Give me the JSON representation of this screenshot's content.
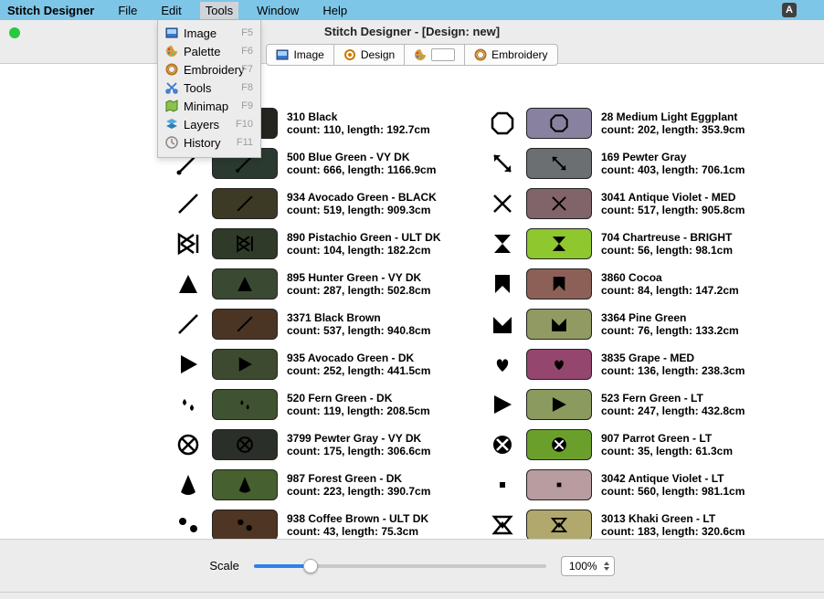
{
  "app_name": "Stitch Designer",
  "menubar": [
    "File",
    "Edit",
    "Tools",
    "Window",
    "Help"
  ],
  "open_menu_index": 2,
  "dropdown": [
    {
      "label": "Image",
      "key": "F5",
      "icon": "image"
    },
    {
      "label": "Palette",
      "key": "F6",
      "icon": "palette"
    },
    {
      "label": "Embroidery",
      "key": "F7",
      "icon": "hoop"
    },
    {
      "label": "Tools",
      "key": "F8",
      "icon": "scissors"
    },
    {
      "label": "Minimap",
      "key": "F9",
      "icon": "map"
    },
    {
      "label": "Layers",
      "key": "F10",
      "icon": "layers"
    },
    {
      "label": "History",
      "key": "F11",
      "icon": "clock"
    }
  ],
  "window_title": "Stitch Designer - [Design: new]",
  "toolbar": {
    "image": "Image",
    "design": "Design",
    "embroidery": "Embroidery"
  },
  "scale": {
    "label": "Scale",
    "value": "100%"
  },
  "left": [
    {
      "sym": "blank",
      "color": "#23251e",
      "stroke": "#000",
      "name": "310 Black",
      "stats": "count: 110, length: 192.7cm"
    },
    {
      "sym": "line_h",
      "color": "#2b3a30",
      "stroke": "#000",
      "name": "500 Blue Green - VY DK",
      "stats": "count: 666, length: 1166.9cm"
    },
    {
      "sym": "slash",
      "color": "#3c3a25",
      "stroke": "#000",
      "name": "934 Avocado Green - BLACK",
      "stats": "count: 519, length: 909.3cm"
    },
    {
      "sym": "tri_left",
      "color": "#2f3a28",
      "stroke": "#000",
      "name": "890 Pistachio Green - ULT DK",
      "stats": "count: 104, length: 182.2cm"
    },
    {
      "sym": "tri_up",
      "color": "#3a4a32",
      "stroke": "#000",
      "name": "895 Hunter Green - VY DK",
      "stats": "count: 287, length: 502.8cm"
    },
    {
      "sym": "slash2",
      "color": "#4a3524",
      "stroke": "#000",
      "name": "3371 Black Brown",
      "stats": "count: 537, length: 940.8cm"
    },
    {
      "sym": "play",
      "color": "#3e4a30",
      "stroke": "#000",
      "name": "935 Avocado Green - DK",
      "stats": "count: 252, length: 441.5cm"
    },
    {
      "sym": "spades",
      "color": "#3f5231",
      "stroke": "#000",
      "name": "520 Fern Green - DK",
      "stats": "count: 119, length: 208.5cm"
    },
    {
      "sym": "shield",
      "color": "#2b2f29",
      "stroke": "#000",
      "name": "3799 Pewter Gray - VY DK",
      "stats": "count: 175, length: 306.6cm"
    },
    {
      "sym": "drop",
      "color": "#46602f",
      "stroke": "#000",
      "name": "987 Forest Green - DK",
      "stats": "count: 223, length: 390.7cm"
    },
    {
      "sym": "twopt",
      "color": "#4f3523",
      "stroke": "#000",
      "name": "938 Coffee Brown - ULT DK",
      "stats": "count: 43, length: 75.3cm"
    }
  ],
  "right": [
    {
      "sym": "oct",
      "color": "#8882a0",
      "name": "28 Medium Light Eggplant",
      "stats": "count: 202, length: 353.9cm"
    },
    {
      "sym": "arrow_d",
      "color": "#6c6f71",
      "name": "169 Pewter Gray",
      "stats": "count: 403, length: 706.1cm"
    },
    {
      "sym": "x",
      "color": "#80646a",
      "name": "3041 Antique Violet - MED",
      "stats": "count: 517, length: 905.8cm"
    },
    {
      "sym": "hourglass",
      "color": "#8fc72f",
      "name": "704 Chartreuse - BRIGHT",
      "stats": "count: 56, length: 98.1cm"
    },
    {
      "sym": "bookmark",
      "color": "#8c6057",
      "name": "3860 Cocoa",
      "stats": "count: 84, length: 147.2cm"
    },
    {
      "sym": "mshape",
      "color": "#919a63",
      "name": "3364 Pine Green",
      "stats": "count: 76, length: 133.2cm"
    },
    {
      "sym": "heart",
      "color": "#94466e",
      "name": "3835 Grape - MED",
      "stats": "count: 136, length: 238.3cm"
    },
    {
      "sym": "flag",
      "color": "#8b9a5e",
      "name": "523 Fern Green - LT",
      "stats": "count: 247, length: 432.8cm"
    },
    {
      "sym": "shield2",
      "color": "#6b9f2b",
      "name": "907 Parrot Green - LT",
      "stats": "count: 35, length: 61.3cm"
    },
    {
      "sym": "dot",
      "color": "#b89ca0",
      "name": "3042 Antique Violet - LT",
      "stats": "count: 560, length: 981.1cm"
    },
    {
      "sym": "diamond",
      "color": "#b0a86c",
      "name": "3013 Khaki Green - LT",
      "stats": "count: 183, length: 320.6cm"
    }
  ]
}
